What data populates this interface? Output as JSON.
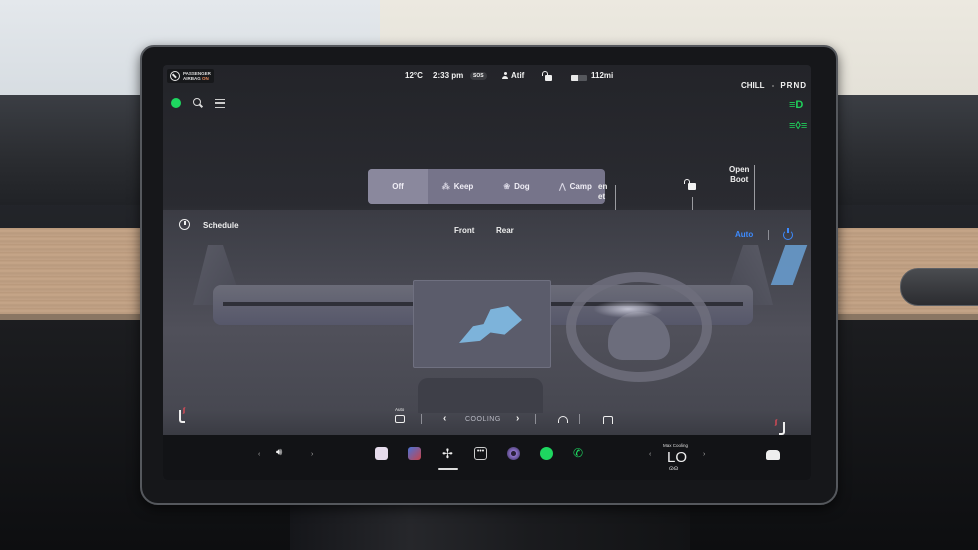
{
  "status_bar": {
    "airbag_line1": "PASSENGER",
    "airbag_line2": "AIRBAG",
    "airbag_state": "ON",
    "temperature": "12°C",
    "time": "2:33 pm",
    "sos_label": "SOS",
    "driver_profile": "Atif",
    "battery_range": "112mi",
    "battery_level_fraction": 0.45,
    "drive_mode": "CHILL",
    "gear_selector": "PRND"
  },
  "top_left_icons": [
    "spotify-icon",
    "search-icon",
    "list-icon"
  ],
  "light_indicators": [
    {
      "name": "low-beam-headlight-icon",
      "color": "#1fd15b"
    },
    {
      "name": "parking-lights-icon",
      "color": "#1fd15b"
    }
  ],
  "car_mode": {
    "options": [
      {
        "label": "Off",
        "icon": "none",
        "selected": true
      },
      {
        "label": "Keep",
        "icon": "fan-person-icon",
        "selected": false
      },
      {
        "label": "Dog",
        "icon": "paw-icon",
        "selected": false
      },
      {
        "label": "Camp",
        "icon": "tent-icon",
        "selected": false
      }
    ]
  },
  "vehicle_controls": {
    "frunk_label_partial": "en\net",
    "boot_label": "Open\nBoot"
  },
  "climate": {
    "schedule_label": "Schedule",
    "tabs": [
      "Front",
      "Rear"
    ],
    "auto_label": "Auto",
    "recirc_label": "Auto",
    "ac_mode": "COOLING",
    "accent_color": "#3d8bff",
    "seat_heat_color": "#ff4d5a"
  },
  "dock": {
    "volume_icon": "speaker-icon",
    "apps": [
      {
        "name": "notes-app"
      },
      {
        "name": "toybox-app"
      },
      {
        "name": "climate-fan-app",
        "active": true
      },
      {
        "name": "more-apps"
      },
      {
        "name": "camera-app"
      },
      {
        "name": "spotify-app"
      },
      {
        "name": "phone-app"
      }
    ],
    "max_cooling_label": "Max Cooling",
    "temperature_setting": "LO",
    "car_icon": "car-icon"
  }
}
